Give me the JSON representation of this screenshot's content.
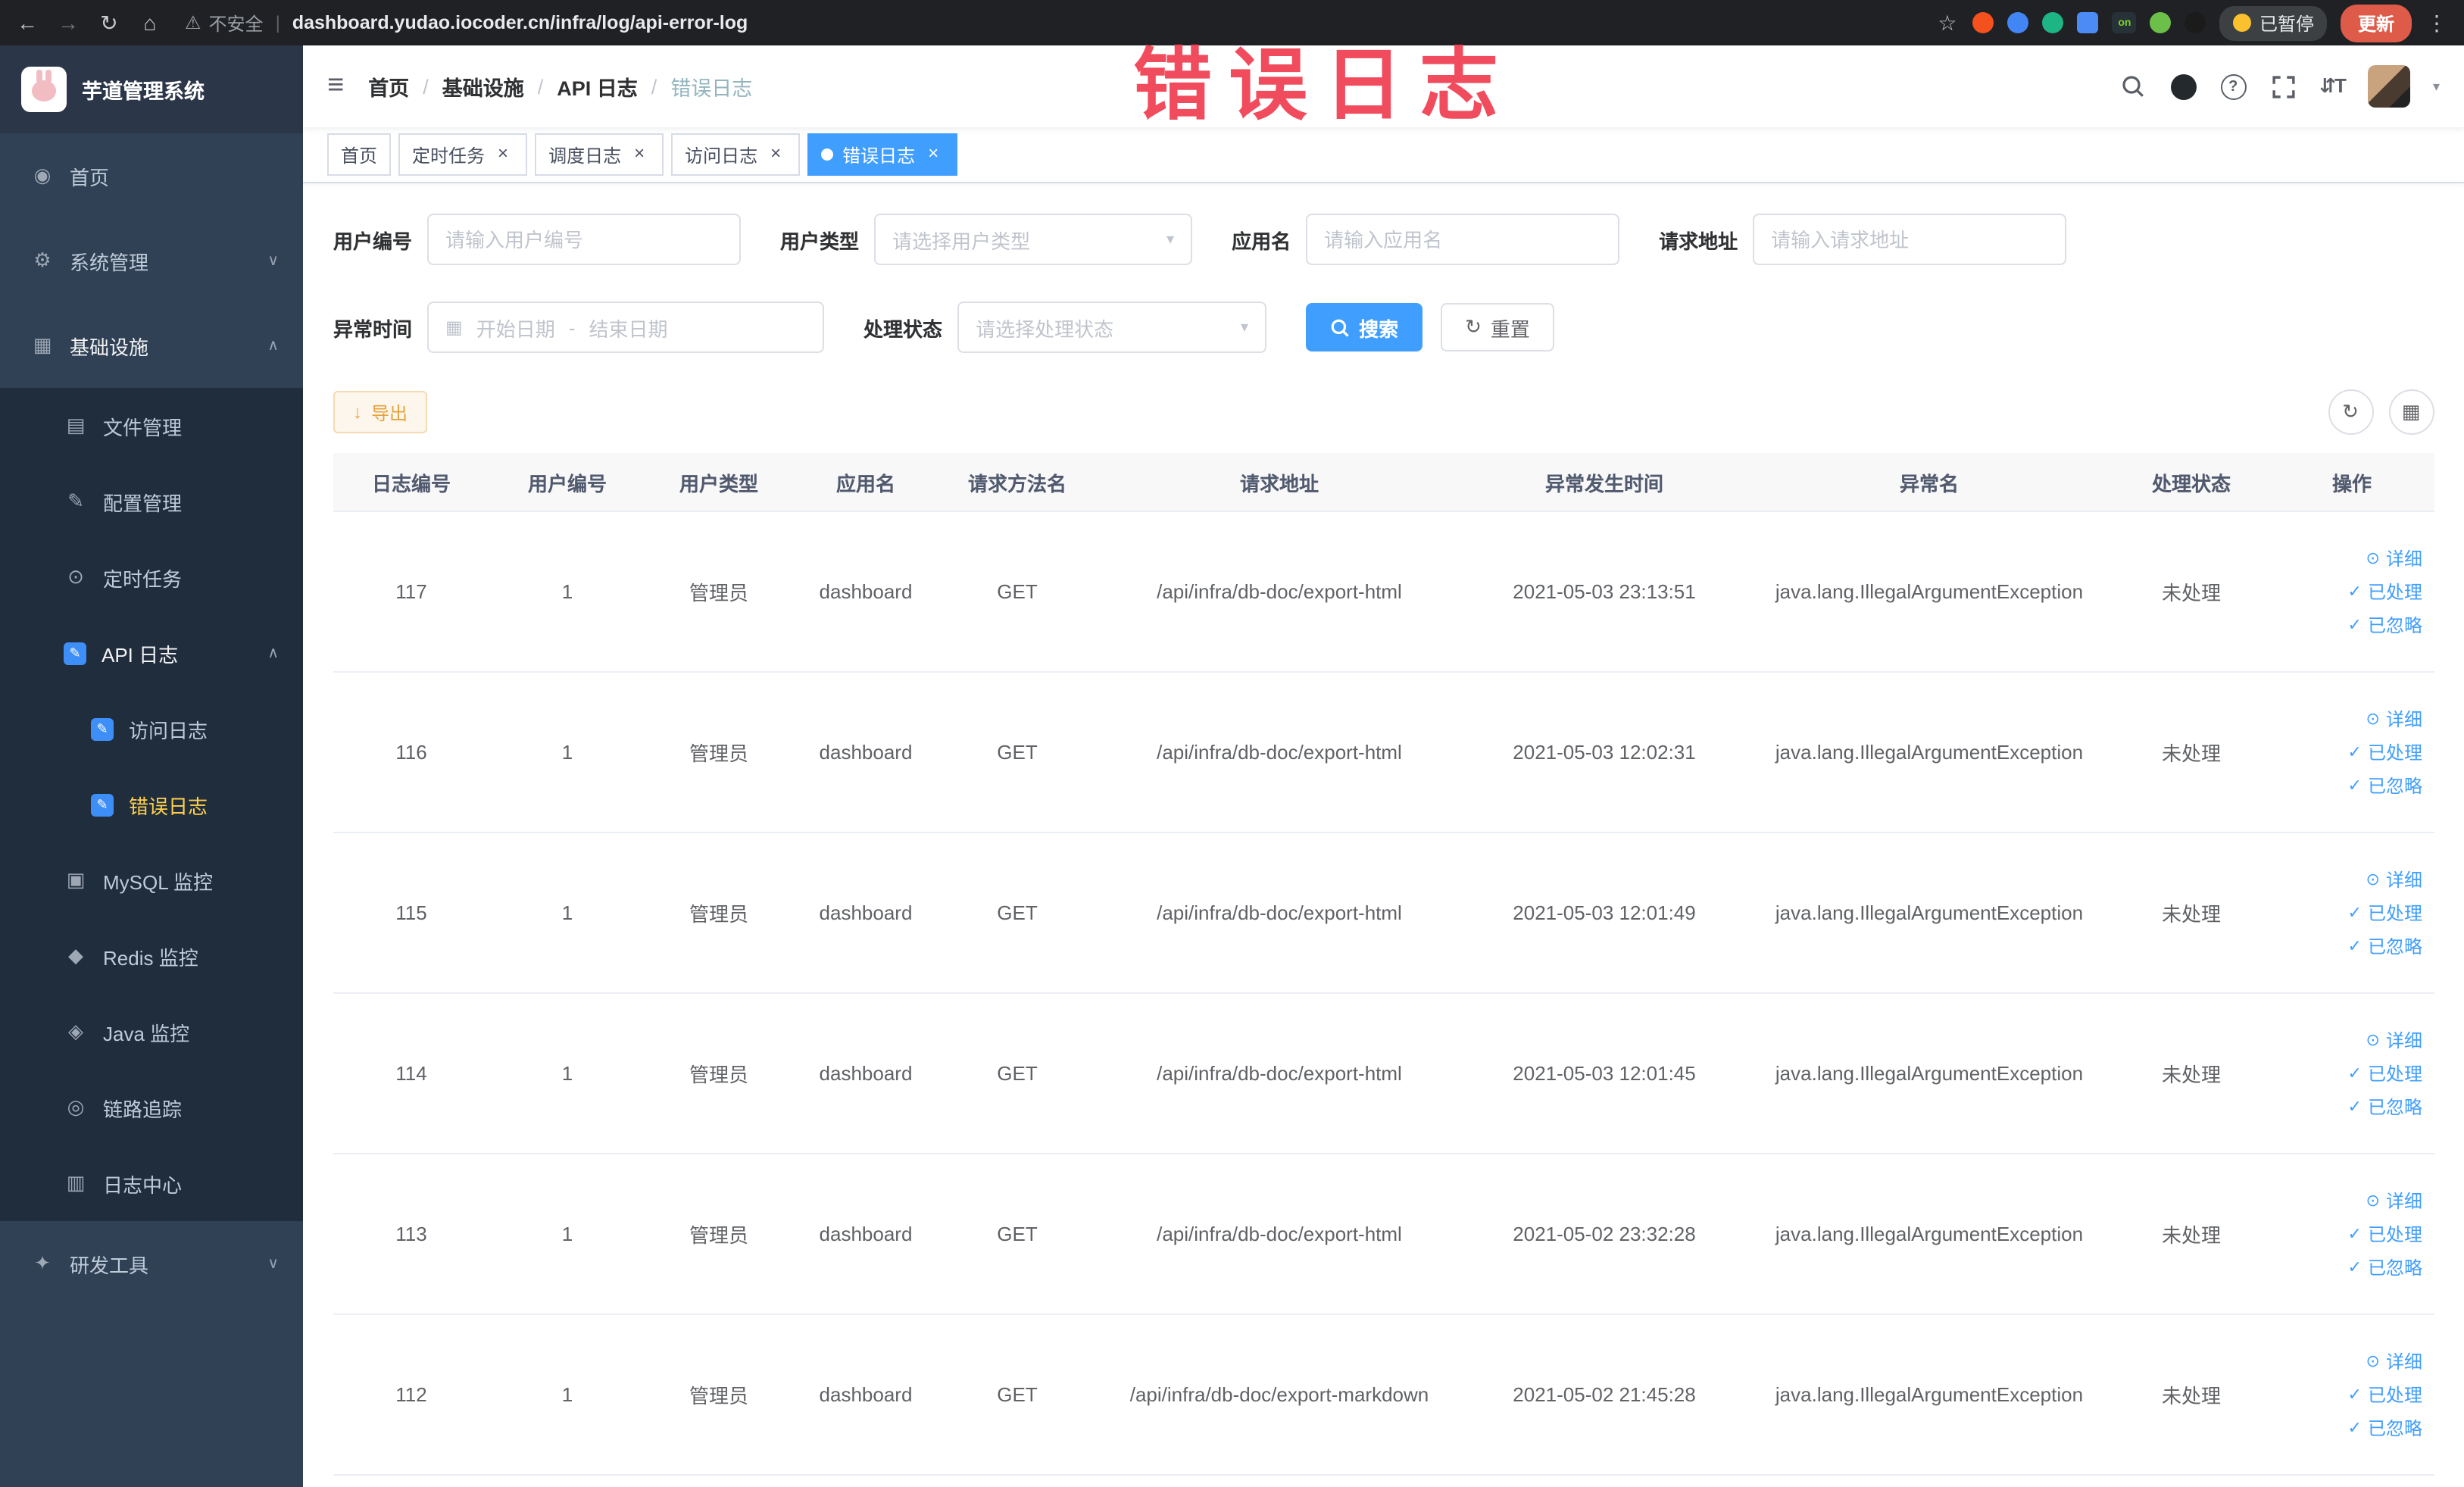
{
  "annotation": {
    "stamp": "错误日志"
  },
  "browser": {
    "security_label": "不安全",
    "url": "dashboard.yudao.iocoder.cn/infra/log/api-error-log",
    "paused_label": "已暂停",
    "update_label": "更新",
    "ext_on_label": "on"
  },
  "icons": {
    "back": "←",
    "forward": "→",
    "reload": "↻",
    "home": "⌂",
    "warning": "⚠",
    "divider": "|",
    "star": "☆",
    "dots": "⋮",
    "hamburger": "≡",
    "breadcrumb_sep": "/",
    "chevron_down": "∨",
    "chevron_up": "∧",
    "select_caret": "▾",
    "caret_down_small": "▾",
    "close": "×",
    "calendar": "▦",
    "download": "↓",
    "refresh": "↻",
    "columns": "▦",
    "check": "✓",
    "eye": "⊙",
    "help": "?",
    "font_size": "⇵T",
    "home_menu": "◉",
    "gear": "⚙",
    "infra": "▦",
    "file": "▤",
    "config": "✎",
    "timer": "⊙",
    "doc": "✎",
    "mysql": "▣",
    "redis": "◆",
    "java": "◈",
    "trace": "◎",
    "logcenter": "▥",
    "tools": "✦"
  },
  "sidebar": {
    "logo_title": "芋道管理系统",
    "items": [
      {
        "label": "首页"
      },
      {
        "label": "系统管理"
      },
      {
        "label": "基础设施"
      },
      {
        "label": "文件管理"
      },
      {
        "label": "配置管理"
      },
      {
        "label": "定时任务"
      },
      {
        "label": "API 日志"
      },
      {
        "label": "访问日志"
      },
      {
        "label": "错误日志"
      },
      {
        "label": "MySQL 监控"
      },
      {
        "label": "Redis 监控"
      },
      {
        "label": "Java 监控"
      },
      {
        "label": "链路追踪"
      },
      {
        "label": "日志中心"
      },
      {
        "label": "研发工具"
      }
    ]
  },
  "navbar": {
    "breadcrumb": {
      "home": "首页",
      "level2": "基础设施",
      "level3": "API 日志",
      "current": "错误日志"
    }
  },
  "tags": {
    "items": [
      {
        "label": "首页"
      },
      {
        "label": "定时任务"
      },
      {
        "label": "调度日志"
      },
      {
        "label": "访问日志"
      },
      {
        "label": "错误日志"
      }
    ]
  },
  "filters": {
    "user_id": {
      "label": "用户编号",
      "placeholder": "请输入用户编号"
    },
    "user_type": {
      "label": "用户类型",
      "placeholder": "请选择用户类型"
    },
    "app_name": {
      "label": "应用名",
      "placeholder": "请输入应用名"
    },
    "request_url": {
      "label": "请求地址",
      "placeholder": "请输入请求地址"
    },
    "exception_time": {
      "label": "异常时间",
      "start_placeholder": "开始日期",
      "separator": "-",
      "end_placeholder": "结束日期"
    },
    "process_status": {
      "label": "处理状态",
      "placeholder": "请选择处理状态"
    },
    "search_label": "搜索",
    "reset_label": "重置"
  },
  "toolbar": {
    "export_label": "导出"
  },
  "table": {
    "headers": [
      "日志编号",
      "用户编号",
      "用户类型",
      "应用名",
      "请求方法名",
      "请求地址",
      "异常发生时间",
      "异常名",
      "处理状态",
      "操作"
    ],
    "actions": {
      "detail": "详细",
      "processed": "已处理",
      "ignored": "已忽略"
    },
    "rows": [
      {
        "id": "117",
        "user_id": "1",
        "user_type": "管理员",
        "app": "dashboard",
        "method": "GET",
        "url": "/api/infra/db-doc/export-html",
        "time": "2021-05-03 23:13:51",
        "exception": "java.lang.IllegalArgumentException",
        "status": "未处理"
      },
      {
        "id": "116",
        "user_id": "1",
        "user_type": "管理员",
        "app": "dashboard",
        "method": "GET",
        "url": "/api/infra/db-doc/export-html",
        "time": "2021-05-03 12:02:31",
        "exception": "java.lang.IllegalArgumentException",
        "status": "未处理"
      },
      {
        "id": "115",
        "user_id": "1",
        "user_type": "管理员",
        "app": "dashboard",
        "method": "GET",
        "url": "/api/infra/db-doc/export-html",
        "time": "2021-05-03 12:01:49",
        "exception": "java.lang.IllegalArgumentException",
        "status": "未处理"
      },
      {
        "id": "114",
        "user_id": "1",
        "user_type": "管理员",
        "app": "dashboard",
        "method": "GET",
        "url": "/api/infra/db-doc/export-html",
        "time": "2021-05-03 12:01:45",
        "exception": "java.lang.IllegalArgumentException",
        "status": "未处理"
      },
      {
        "id": "113",
        "user_id": "1",
        "user_type": "管理员",
        "app": "dashboard",
        "method": "GET",
        "url": "/api/infra/db-doc/export-html",
        "time": "2021-05-02 23:32:28",
        "exception": "java.lang.IllegalArgumentException",
        "status": "未处理"
      },
      {
        "id": "112",
        "user_id": "1",
        "user_type": "管理员",
        "app": "dashboard",
        "method": "GET",
        "url": "/api/infra/db-doc/export-markdown",
        "time": "2021-05-02 21:45:28",
        "exception": "java.lang.IllegalArgumentException",
        "status": "未处理"
      }
    ]
  },
  "colors": {
    "accent": "#409eff",
    "sidebar_bg": "#304156",
    "submenu_bg": "#1f2d3d",
    "active_menu_text": "#ffd04b",
    "warning": "#e6a23c",
    "stamp": "#f03f51"
  }
}
